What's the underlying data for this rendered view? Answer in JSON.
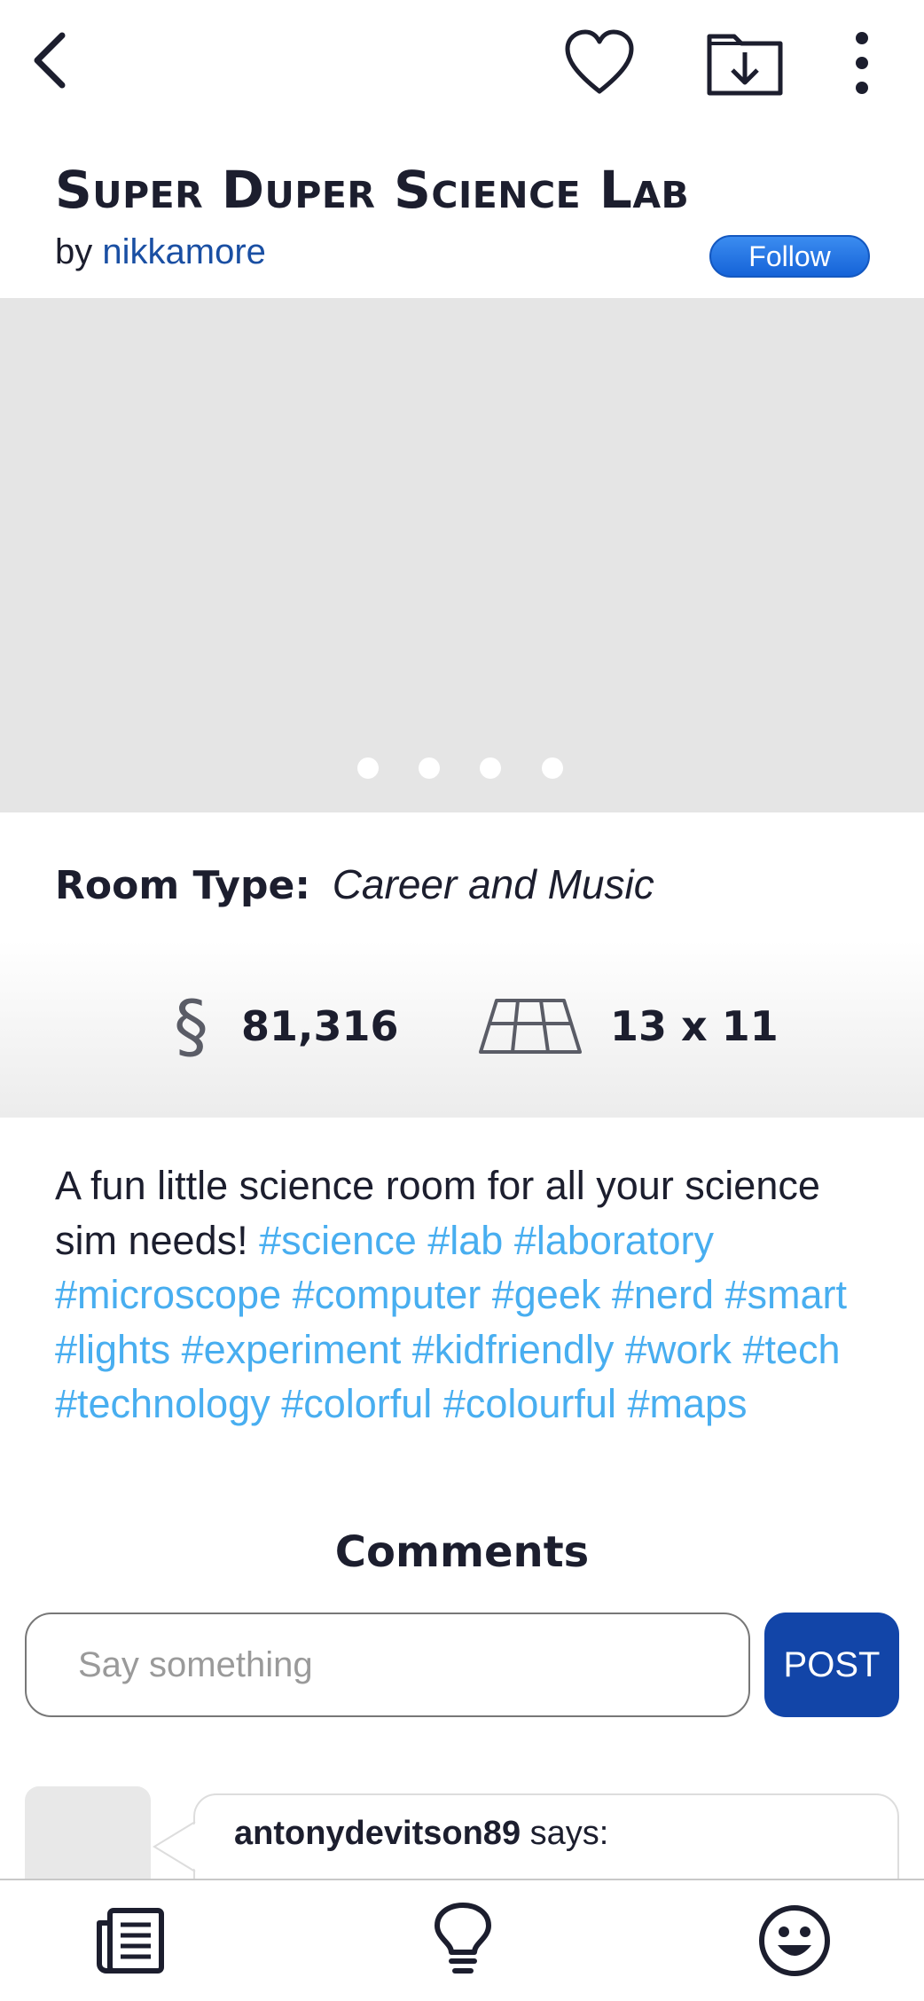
{
  "header": {
    "back_icon": "chevron-left-icon",
    "favorite_icon": "heart-icon",
    "download_icon": "download-folder-icon",
    "more_icon": "more-vertical-icon"
  },
  "listing": {
    "title": "Super Duper Science Lab",
    "by_label": "by",
    "author": "nikkamore",
    "follow_label": "Follow",
    "gallery_pages": 4,
    "gallery_current_page": 1
  },
  "room": {
    "type_label": "Room Type:",
    "type_value": "Career and Music",
    "currency_symbol": "§",
    "price": "81,316",
    "size": "13 x 11"
  },
  "description": {
    "text": "A fun little science room for all your science sim needs!",
    "tags": [
      "#science",
      "#lab",
      "#laboratory",
      "#microscope",
      "#computer",
      "#geek",
      "#nerd",
      "#smart",
      "#lights",
      "#experiment",
      "#kidfriendly",
      "#work",
      "#tech",
      "#technology",
      "#colorful",
      "#colourful",
      "#maps"
    ]
  },
  "comments": {
    "title": "Comments",
    "input_placeholder": "Say something",
    "post_label": "POST",
    "items": [
      {
        "author": "antonydevitson89",
        "says_label": "says:"
      }
    ]
  },
  "bottom_nav": {
    "items": [
      "news-icon",
      "lightbulb-icon",
      "smiley-icon"
    ]
  },
  "colors": {
    "accent_blue": "#1245a8",
    "author_link": "#1a4fa3",
    "hashtag": "#48aef0",
    "follow_button": "#1f6fe0"
  }
}
